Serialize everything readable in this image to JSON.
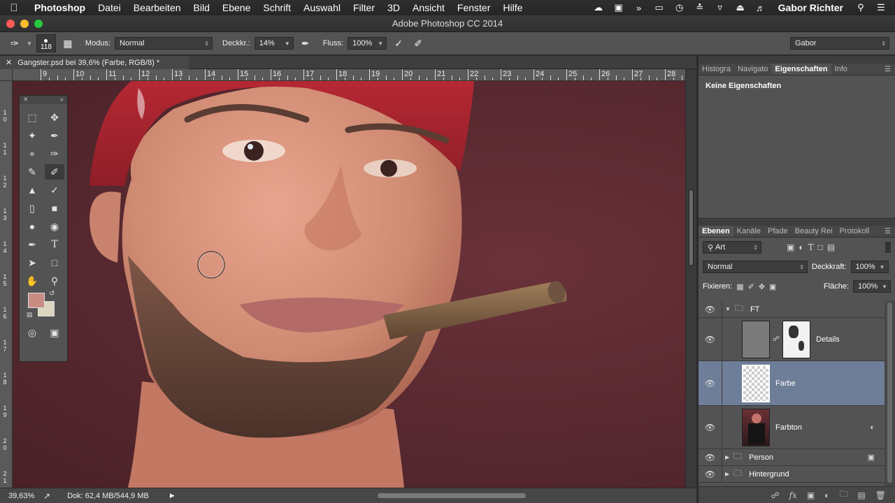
{
  "menubar": {
    "app": "Photoshop",
    "items": [
      "Datei",
      "Bearbeiten",
      "Bild",
      "Ebene",
      "Schrift",
      "Auswahl",
      "Filter",
      "3D",
      "Ansicht",
      "Fenster",
      "Hilfe"
    ],
    "user": "Gabor Richter"
  },
  "window": {
    "title": "Adobe Photoshop CC 2014"
  },
  "options": {
    "brush_size": "118",
    "mode_label": "Modus:",
    "mode_value": "Normal",
    "opacity_label": "Deckkr.:",
    "opacity_value": "14%",
    "flow_label": "Fluss:",
    "flow_value": "100%",
    "workspace": "Gabor"
  },
  "document": {
    "tab_title": "Gangster.psd bei 39,6% (Farbe, RGB/8) *"
  },
  "ruler": {
    "h_labels": [
      "9",
      "10",
      "11",
      "12",
      "13",
      "14",
      "15",
      "16",
      "17",
      "18",
      "19",
      "20",
      "21",
      "22",
      "23",
      "24",
      "25",
      "26",
      "27",
      "28"
    ],
    "v_labels": [
      "1\n0",
      "1\n1",
      "1\n2",
      "1\n3",
      "1\n4",
      "1\n5",
      "1\n6",
      "1\n7",
      "1\n8",
      "1\n9",
      "2\n0",
      "2\n1"
    ]
  },
  "status": {
    "zoom": "39,63%",
    "doc": "Dok: 62,4 MB/544,9 MB"
  },
  "panels": {
    "top_tabs": [
      "Histogra",
      "Navigato",
      "Eigenschaften",
      "Info"
    ],
    "properties_text": "Keine Eigenschaften",
    "layer_tabs": [
      "Ebenen",
      "Kanäle",
      "Pfade",
      "Beauty Rei",
      "Protokoll"
    ],
    "filter_value": "Art",
    "blend_mode": "Normal",
    "opacity_label": "Deckkraft:",
    "opacity_value": "100%",
    "lock_label": "Fixieren:",
    "fill_label": "Fläche:",
    "fill_value": "100%"
  },
  "layers": [
    {
      "name": "FT",
      "type": "group-open"
    },
    {
      "name": "Details",
      "type": "layer-mask"
    },
    {
      "name": "Farbe",
      "type": "layer",
      "selected": true
    },
    {
      "name": "Farbton",
      "type": "smart"
    },
    {
      "name": "Person",
      "type": "group"
    },
    {
      "name": "Hintergrund",
      "type": "group"
    }
  ],
  "colors": {
    "foreground": "#c88c83",
    "background": "#dcd6c0",
    "selection": "#6f7e98"
  }
}
